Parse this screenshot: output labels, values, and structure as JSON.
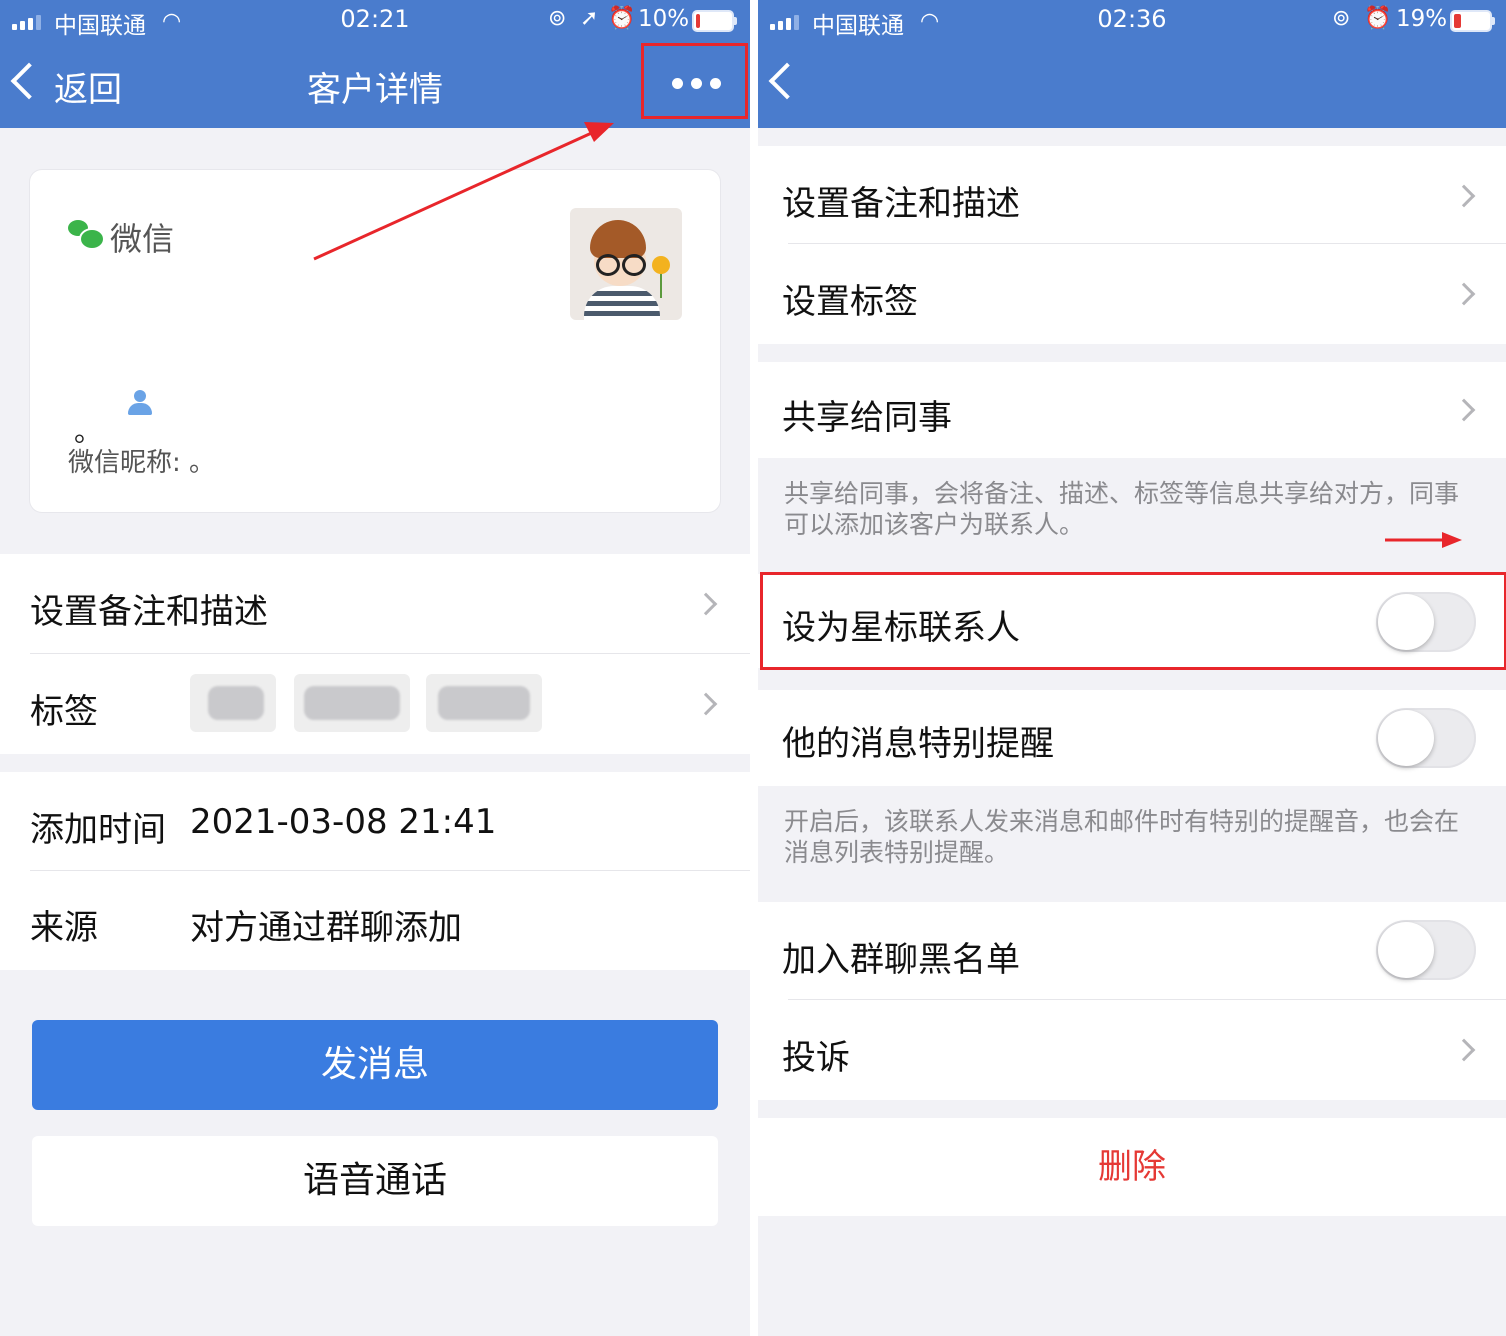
{
  "colors": {
    "nav_blue": "#4a7ccd",
    "button_blue": "#3a7ce0",
    "annotation_red": "#e8262b",
    "delete_red": "#e53935",
    "wechat_green": "#3bb44a"
  },
  "left": {
    "status": {
      "carrier": "中国联通",
      "time": "02:21",
      "battery": "10%"
    },
    "nav": {
      "back_label": "返回",
      "title": "客户详情",
      "more_icon": "more-dots-icon"
    },
    "card": {
      "source": "微信",
      "dot": "。",
      "nickname": "微信昵称: 。"
    },
    "rows": {
      "remark": "设置备注和描述",
      "tags_label": "标签",
      "add_time_label": "添加时间",
      "add_time_value": "2021-03-08 21:41",
      "source_label": "来源",
      "source_value": "对方通过群聊添加"
    },
    "buttons": {
      "message": "发消息",
      "voice_call": "语音通话"
    }
  },
  "right": {
    "status": {
      "carrier": "中国联通",
      "time": "02:36",
      "battery": "19%"
    },
    "items": {
      "remark": "设置备注和描述",
      "tags": "设置标签",
      "share": "共享给同事",
      "share_note": "共享给同事，会将备注、描述、标签等信息共享给对方，同事可以添加该客户为联系人。",
      "star": "设为星标联系人",
      "special_alert": "他的消息特别提醒",
      "alert_note": "开启后，该联系人发来消息和邮件时有特别的提醒音，也会在消息列表特别提醒。",
      "blacklist": "加入群聊黑名单",
      "complain": "投诉",
      "delete": "删除"
    },
    "toggles": {
      "star": false,
      "special_alert": false,
      "blacklist": false
    }
  }
}
